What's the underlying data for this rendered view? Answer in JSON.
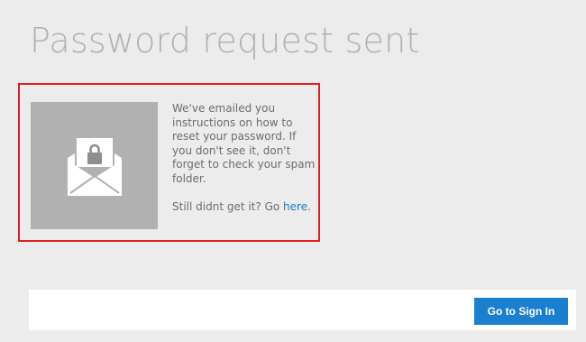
{
  "page": {
    "title": "Password request sent"
  },
  "message": {
    "paragraph": "We've emailed you instructions on how to reset your password. If you don't see it, don't forget to check your spam folder.",
    "still_prefix": "Still didnt get it? Go ",
    "here_link": "here",
    "still_suffix": "."
  },
  "footer": {
    "signin_button": "Go to Sign In"
  },
  "colors": {
    "accent": "#1b7fd0",
    "highlight_border": "#e02020",
    "image_tile": "#b1b1b1"
  },
  "icons": {
    "envelope": "envelope-lock-icon"
  }
}
